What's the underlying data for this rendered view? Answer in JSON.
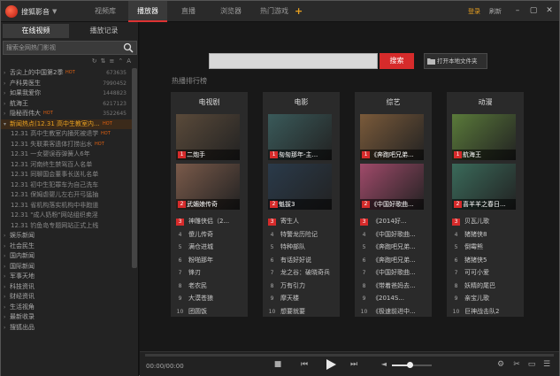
{
  "app": {
    "title": "搜狐影音"
  },
  "titlebar": {
    "tabs": [
      {
        "label": "视频库",
        "active": false
      },
      {
        "label": "播放器",
        "active": true
      },
      {
        "label": "直播",
        "active": false
      },
      {
        "label": "浏览器",
        "active": false
      },
      {
        "label": "热门游戏",
        "active": false
      }
    ],
    "login": "登录",
    "refresh": "刷新"
  },
  "sidebar": {
    "tabs": [
      {
        "label": "在线视频",
        "active": true
      },
      {
        "label": "播放记录",
        "active": false
      }
    ],
    "search_placeholder": "搜索全网热门影视",
    "items": [
      {
        "label": "舌尖上的中国第2季",
        "hot": "HOT",
        "count": "673635",
        "type": "item"
      },
      {
        "label": "产科男医生",
        "hot": "",
        "count": "7990452",
        "type": "item"
      },
      {
        "label": "如果我爱你",
        "hot": "",
        "count": "1448823",
        "type": "item"
      },
      {
        "label": "航海王",
        "hot": "",
        "count": "6217123",
        "type": "item"
      },
      {
        "label": "隐秘而伟大",
        "hot": "HOT",
        "count": "3522645",
        "type": "item"
      },
      {
        "label": "新闻热点(12.31 高中生教室内...",
        "hot": "HOT",
        "count": "",
        "type": "selected"
      },
      {
        "label": "12.31 高中生教室内捅死被退学",
        "hot": "HOT",
        "count": "",
        "type": "child"
      },
      {
        "label": "12.31 失联乘客遗体打捞出水",
        "hot": "HOT",
        "count": "",
        "type": "child"
      },
      {
        "label": "12.31 一女婴误吞弹簧人6年",
        "hot": "",
        "count": "",
        "type": "child"
      },
      {
        "label": "12.31 河南终生禁驾百人名单",
        "hot": "",
        "count": "",
        "type": "child"
      },
      {
        "label": "12.31 同聊国会董事长送礼名单",
        "hot": "",
        "count": "",
        "type": "child"
      },
      {
        "label": "12.31 初中生犯罪车为自己洗车",
        "hot": "",
        "count": "",
        "type": "child"
      },
      {
        "label": "12.31 保姆虐婴儿左右开弓猛抽",
        "hot": "",
        "count": "",
        "type": "child"
      },
      {
        "label": "12.31 省机构落实机构中非跑道",
        "hot": "",
        "count": "",
        "type": "child"
      },
      {
        "label": "12.31 \"成人奶粉\"网站组织卖淫",
        "hot": "",
        "count": "",
        "type": "child"
      },
      {
        "label": "12.31 钓鱼岛专题网站正式上线",
        "hot": "",
        "count": "",
        "type": "child"
      },
      {
        "label": "娱乐新闻",
        "hot": "",
        "count": "",
        "type": "item"
      },
      {
        "label": "社会民生",
        "hot": "",
        "count": "",
        "type": "item"
      },
      {
        "label": "国内新闻",
        "hot": "",
        "count": "",
        "type": "item"
      },
      {
        "label": "国际新闻",
        "hot": "",
        "count": "",
        "type": "item"
      },
      {
        "label": "军事天地",
        "hot": "",
        "count": "",
        "type": "item"
      },
      {
        "label": "科技资讯",
        "hot": "",
        "count": "",
        "type": "item"
      },
      {
        "label": "财经资讯",
        "hot": "",
        "count": "",
        "type": "item"
      },
      {
        "label": "生活视角",
        "hot": "",
        "count": "",
        "type": "item"
      },
      {
        "label": "最新收录",
        "hot": "",
        "count": "",
        "type": "group"
      },
      {
        "label": "搜狐出品",
        "hot": "",
        "count": "",
        "type": "group"
      }
    ]
  },
  "main": {
    "search_button": "搜索",
    "open_folder": "打开本地文件夹",
    "rank_title": "热播排行榜",
    "columns": [
      {
        "title": "电视剧",
        "top": [
          {
            "n": "1",
            "label": "二炮手"
          },
          {
            "n": "2",
            "label": "武媚娘传奇"
          }
        ],
        "rows": [
          "神雕侠侣（2...",
          "傻儿传奇",
          "满仓进城",
          "粉啪那年",
          "锋刃",
          "老农民",
          "大漠苍狼",
          "团圆饭"
        ]
      },
      {
        "title": "电影",
        "top": [
          {
            "n": "1",
            "label": "匆匆那年-主..."
          },
          {
            "n": "2",
            "label": "魁拔3"
          }
        ],
        "rows": [
          "寄生人",
          "特警龙历险记",
          "特种部队",
          "有话好好说",
          "龙之谷：破晓奇兵",
          "万有引力",
          "摩天楼",
          "想要就要"
        ]
      },
      {
        "title": "综艺",
        "top": [
          {
            "n": "1",
            "label": "《奔跑吧兄弟..."
          },
          {
            "n": "2",
            "label": "《中国好歌曲..."
          }
        ],
        "rows": [
          "《2014好...",
          "《中国好歌曲...",
          "《奔跑吧兄弟...",
          "《奔跑吧兄弟...",
          "《中国好歌曲...",
          "《带着爸妈去...",
          "《2014S...",
          "《极速前进中..."
        ]
      },
      {
        "title": "动漫",
        "top": [
          {
            "n": "1",
            "label": "航海王"
          },
          {
            "n": "2",
            "label": "喜羊羊之春日..."
          }
        ],
        "rows": [
          "贝瓦儿歌",
          "猪猪侠8",
          "倒霉熊",
          "猪猪侠5",
          "可可小爱",
          "妖精的尾巴",
          "亲宝儿歌",
          "巨神战击队2"
        ]
      }
    ]
  },
  "player": {
    "time": "00:00/00:00",
    "volume_fraction": 0.45
  }
}
